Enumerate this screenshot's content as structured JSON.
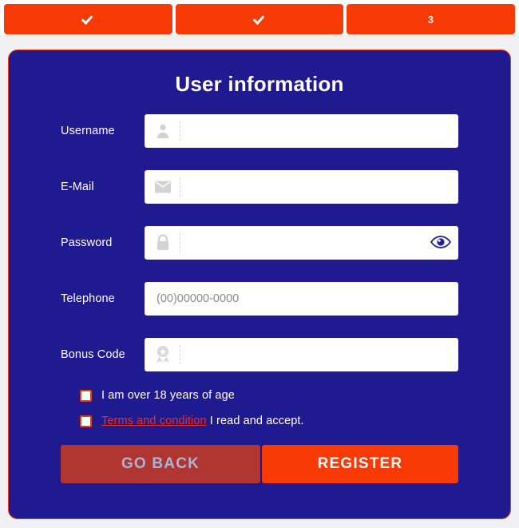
{
  "stepper": {
    "steps": [
      {
        "label": "",
        "state": "complete",
        "icon": "check-icon"
      },
      {
        "label": "",
        "state": "complete",
        "icon": "check-icon"
      },
      {
        "label": "3",
        "state": "current",
        "icon": ""
      }
    ]
  },
  "card": {
    "title": "User information",
    "fields": [
      {
        "label": "Username",
        "icon": "user-icon",
        "value": "",
        "placeholder": ""
      },
      {
        "label": "E-Mail",
        "icon": "envelope-icon",
        "value": "",
        "placeholder": ""
      },
      {
        "label": "Password",
        "icon": "lock-icon",
        "value": "",
        "placeholder": "",
        "trailing_icon": "eye-icon"
      },
      {
        "label": "Telephone",
        "icon": "",
        "value": "",
        "placeholder": "(00)00000-0000"
      },
      {
        "label": "Bonus Code",
        "icon": "medal-icon",
        "value": "",
        "placeholder": ""
      }
    ],
    "checkboxes": [
      {
        "checked": false,
        "text": "I am over 18 years of age",
        "link": "",
        "rest": ""
      },
      {
        "checked": false,
        "text": "",
        "link": "Terms and condition",
        "rest": " I read and accept."
      }
    ],
    "buttons": {
      "back": "GO BACK",
      "register": "REGISTER"
    }
  },
  "colors": {
    "accent_orange": "#f73a06",
    "panel_blue": "#201a91",
    "link_red": "#f22d12",
    "back_button": "#b03632",
    "page_bg": "#f1f1f3"
  }
}
